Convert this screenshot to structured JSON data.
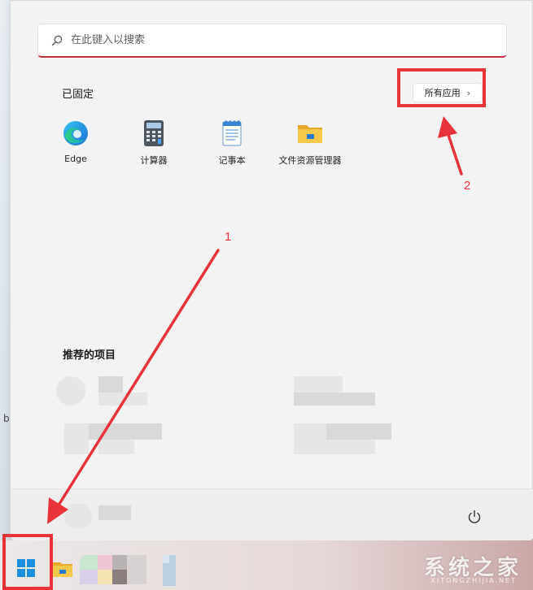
{
  "search": {
    "placeholder": "在此键入以搜索"
  },
  "pinned": {
    "title": "已固定",
    "all_apps_label": "所有应用",
    "apps": [
      {
        "label": "Edge",
        "icon": "edge-icon"
      },
      {
        "label": "计算器",
        "icon": "calculator-icon"
      },
      {
        "label": "记事本",
        "icon": "notepad-icon"
      },
      {
        "label": "文件资源管理器",
        "icon": "file-explorer-icon"
      }
    ]
  },
  "recommended": {
    "title": "推荐的项目"
  },
  "footer": {
    "power_icon": "power-icon"
  },
  "annotations": {
    "num1": "1",
    "num2": "2"
  },
  "watermark": {
    "text": "系统之家",
    "sub": "XITONGZHIJIA.NET"
  },
  "colors": {
    "accent": "#c42b3a",
    "annotation": "#e8333a"
  }
}
